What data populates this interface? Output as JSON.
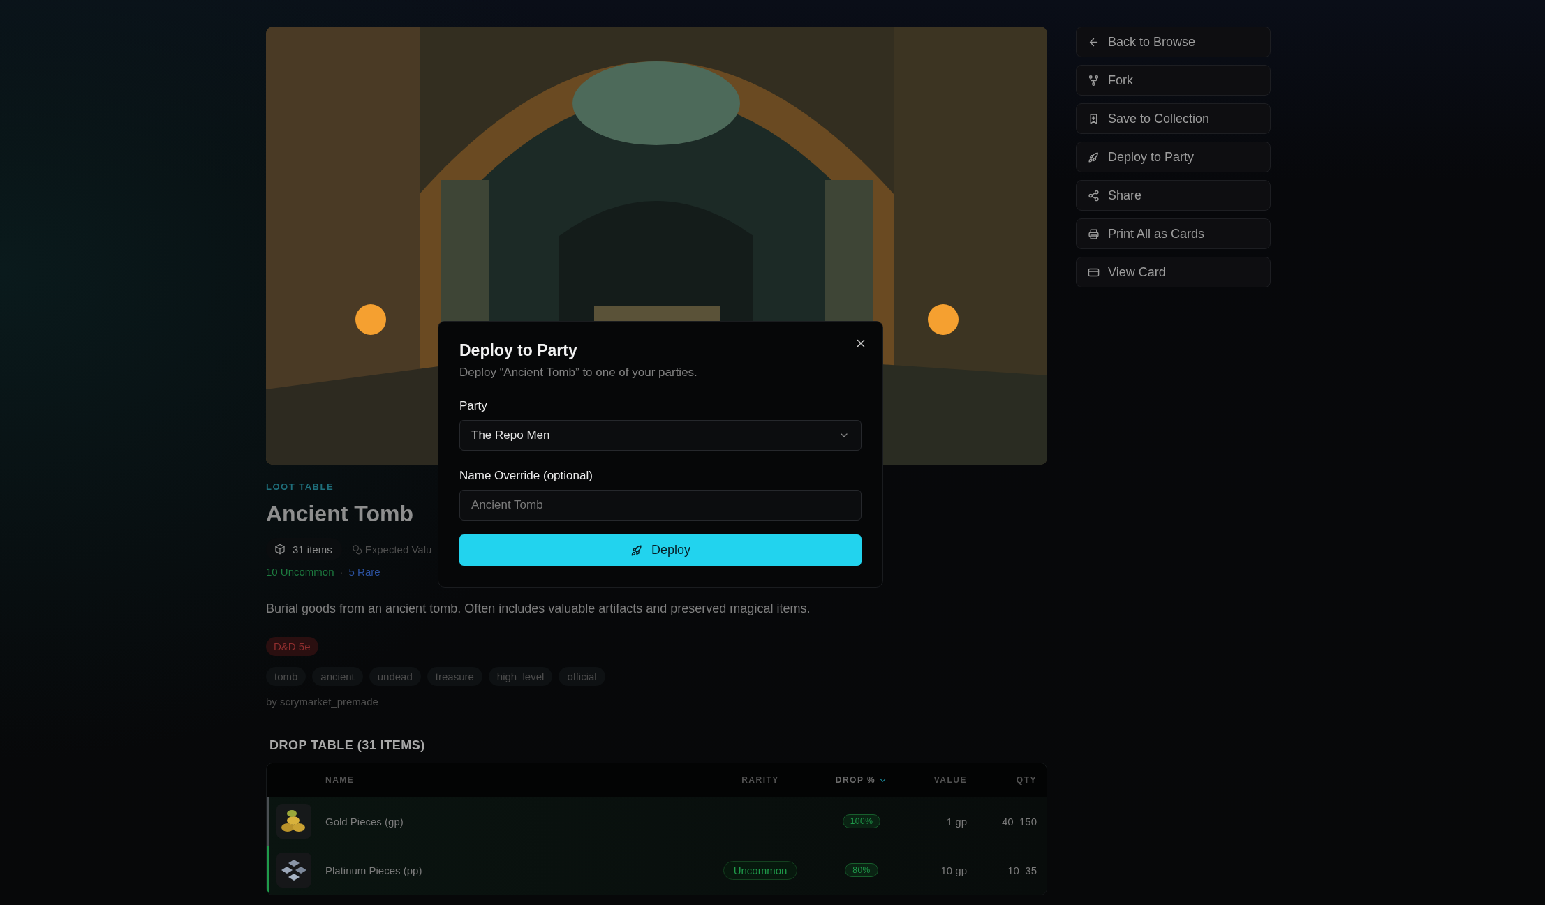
{
  "actions": [
    {
      "label": "Back to Browse"
    },
    {
      "label": "Fork"
    },
    {
      "label": "Save to Collection"
    },
    {
      "label": "Deploy to Party"
    },
    {
      "label": "Share"
    },
    {
      "label": "Print All as Cards"
    },
    {
      "label": "View Card"
    }
  ],
  "header": {
    "eyebrow": "LOOT TABLE",
    "title": "Ancient Tomb",
    "stats": [
      {
        "label": "31 items"
      },
      {
        "label": "Expected Valu"
      }
    ],
    "rarity_summary": [
      {
        "label": "10 Uncommon",
        "color": "#1d7a3f"
      },
      {
        "label": "5 Rare",
        "color": "#2c52a0"
      }
    ],
    "separator": "·",
    "description": "Burial goods from an ancient tomb. Often includes valuable artifacts and preserved magical items.",
    "system_badge": "D&D 5e",
    "tags": [
      "tomb",
      "ancient",
      "undead",
      "treasure",
      "high_level",
      "official"
    ],
    "author": "by scrymarket_premade"
  },
  "drop_table": {
    "title": "DROP TABLE (31 ITEMS)",
    "columns": [
      {
        "label": "NAME",
        "sorted": false
      },
      {
        "label": "RARITY",
        "sorted": false
      },
      {
        "label": "DROP %",
        "sorted": true
      },
      {
        "label": "VALUE",
        "sorted": false
      },
      {
        "label": "QTY",
        "sorted": false
      }
    ],
    "rows": [
      {
        "name": "Gold Pieces (gp)",
        "color": "#4a4f53",
        "drop": "100%",
        "value": "1 gp",
        "qty": "40–150"
      },
      {
        "name": "Platinum Pieces (pp)",
        "color": "#1f9a4a",
        "rarity": "Uncommon",
        "drop": "80%",
        "value": "10 gp",
        "qty": "10–35"
      }
    ]
  },
  "modal": {
    "title": "Deploy to Party",
    "subtitle": "Deploy “Ancient Tomb” to one of your parties.",
    "fields": [
      {
        "label": "Party",
        "kind": "select",
        "value": "The Repo Men"
      },
      {
        "label": "Name Override (optional)",
        "kind": "text",
        "placeholder": "Ancient Tomb"
      }
    ],
    "submit": "Deploy"
  }
}
